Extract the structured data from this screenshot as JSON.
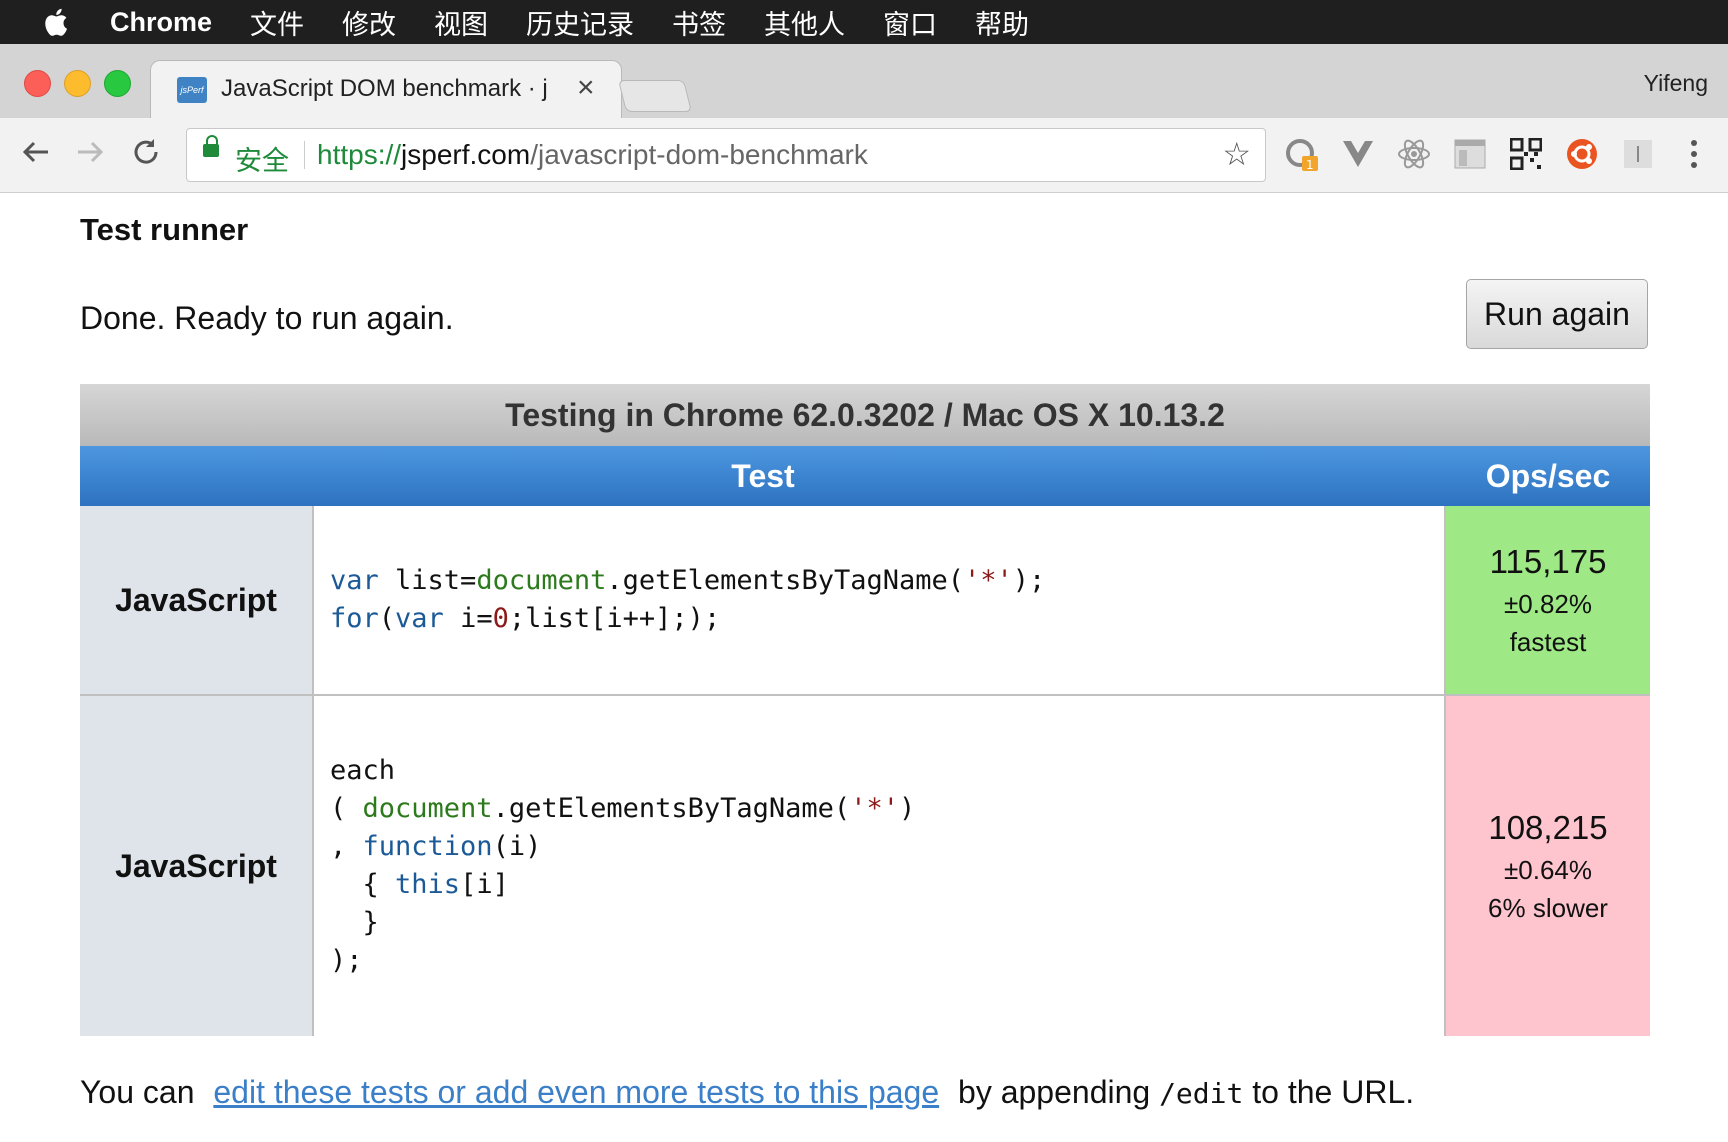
{
  "menubar": {
    "app": "Chrome",
    "items": [
      "文件",
      "修改",
      "视图",
      "历史记录",
      "书签",
      "其他人",
      "窗口",
      "帮助"
    ]
  },
  "tab": {
    "favicon_text": "jsPerf",
    "title": "JavaScript DOM benchmark · j"
  },
  "profile": {
    "name": "Yifeng"
  },
  "omnibox": {
    "secure_label": "安全",
    "url_scheme": "https://",
    "url_host": "jsperf.com",
    "url_path": "/javascript-dom-benchmark"
  },
  "extensions": {
    "badge": "1"
  },
  "page": {
    "heading": "Test runner",
    "status": "Done. Ready to run again.",
    "run_button": "Run again",
    "caption": "Testing in Chrome 62.0.3202 / Mac OS X 10.13.2",
    "col_test": "Test",
    "col_ops": "Ops/sec",
    "tests": [
      {
        "lang": "JavaScript",
        "ops": "115,175",
        "error": "±0.82%",
        "note": "fastest"
      },
      {
        "lang": "JavaScript",
        "ops": "108,215",
        "error": "±0.64%",
        "note": "6% slower"
      }
    ],
    "footer": {
      "prefix": "You can",
      "link": "edit these tests or add even more tests to this page",
      "middle": "by appending",
      "code": "/edit",
      "suffix": "to the URL."
    }
  },
  "colors": {
    "fastest_bg": "#9ee885",
    "slower_bg": "#fec5cf",
    "header_blue": "#3a84d0",
    "secure_green": "#1e8a3a",
    "link_blue": "#3a7fc8"
  }
}
